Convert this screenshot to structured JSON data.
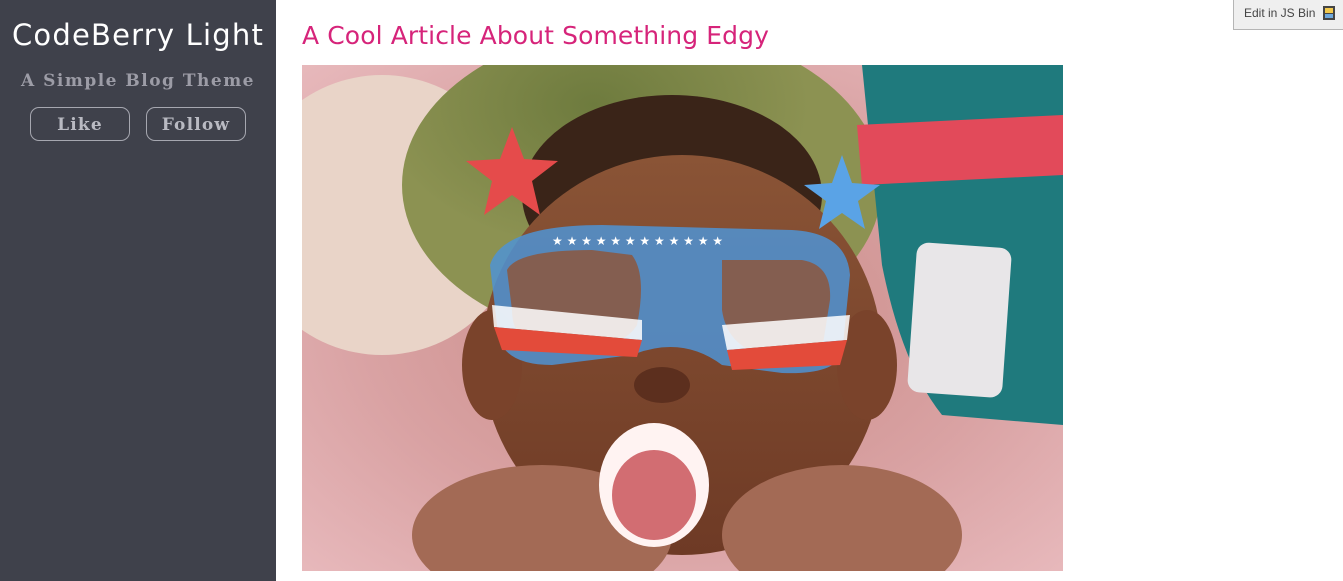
{
  "sidebar": {
    "title": "CodeBerry Light",
    "tagline": "A Simple Blog Theme",
    "buttons": {
      "like": "Like",
      "follow": "Follow"
    }
  },
  "article": {
    "title": "A Cool Article About Something Edgy",
    "image_icon": "photo-kid-star-glasses"
  },
  "jsbin": {
    "label": "Edit in JS Bin",
    "icon": "jsbin-icon"
  },
  "colors": {
    "sidebar_bg": "#3f414b",
    "title_accent": "#d6247a"
  }
}
